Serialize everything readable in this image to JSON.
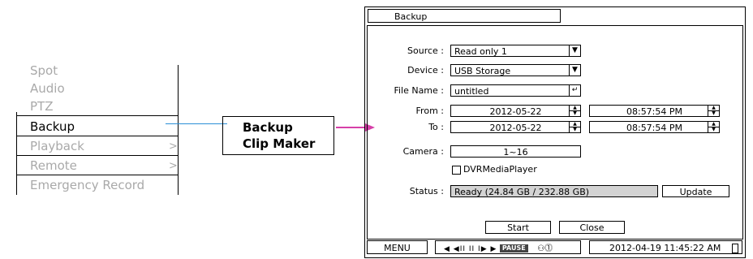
{
  "menu": {
    "items": [
      {
        "label": "Spot",
        "state": "disabled"
      },
      {
        "label": "Audio",
        "state": "disabled"
      },
      {
        "label": "PTZ",
        "state": "disabled"
      },
      {
        "label": "Backup",
        "state": "active"
      },
      {
        "label": "Playback",
        "state": "disabled",
        "submenu": true
      },
      {
        "label": "Remote",
        "state": "disabled",
        "submenu": true
      },
      {
        "label": "Emergency Record",
        "state": "disabled"
      }
    ],
    "chevron": ">"
  },
  "submenu": {
    "items": [
      "Backup",
      "Clip Maker"
    ]
  },
  "colors": {
    "connector": "#2b8fd6",
    "arrow": "#d63fa8",
    "disabled_text": "#a9a9a9",
    "status_fill": "#d3d3d3"
  },
  "dialog": {
    "tab_label": "Backup",
    "source": {
      "label": "Source :",
      "value": "Read only 1"
    },
    "device": {
      "label": "Device :",
      "value": "USB Storage"
    },
    "file_name": {
      "label": "File Name :",
      "value": "untitled"
    },
    "from": {
      "label": "From :",
      "date": "2012-05-22",
      "time": "08:57:54 PM"
    },
    "to": {
      "label": "To :",
      "date": "2012-05-22",
      "time": "08:57:54 PM"
    },
    "camera": {
      "label": "Camera :",
      "value": "1~16"
    },
    "dvr_media_player": {
      "label": "DVRMediaPlayer",
      "checked": false
    },
    "status": {
      "label": "Status :",
      "value": "Ready  (24.84 GB / 232.88 GB)"
    },
    "update_label": "Update",
    "start_label": "Start",
    "close_label": "Close"
  },
  "bottom_bar": {
    "menu_label": "MENU",
    "playback_controls": "◀ ◀II II I▶ ▶",
    "pause_label": "PAUSE",
    "datetime": "2012-04-19 11:45:22 AM"
  },
  "icons": [
    "dropdown-arrow-icon",
    "enter-icon",
    "spinner-icon",
    "network-icon",
    "alarm-icon",
    "battery-icon"
  ]
}
